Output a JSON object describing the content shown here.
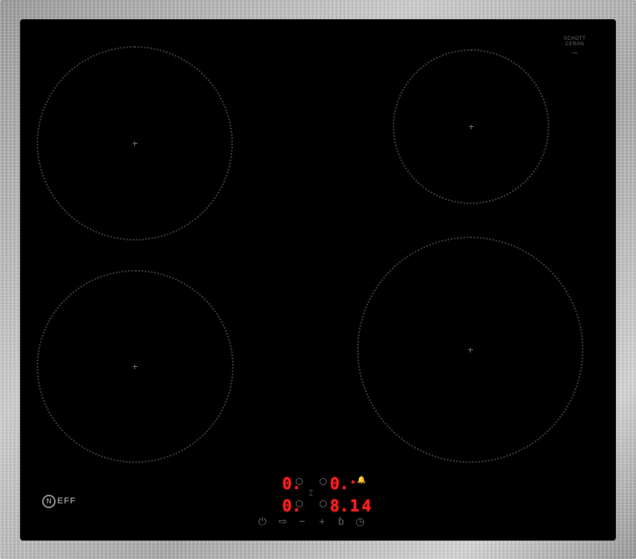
{
  "glass_ceramic": {
    "line1": "SCHOTT",
    "line2": "CERAN",
    "line3": "TM",
    "line4": ""
  },
  "brand": {
    "logo_letter": "N",
    "logo_text": "EFF"
  },
  "display": {
    "zone_left_top": "0.",
    "zone_left_bottom": "0.",
    "zone_right_top": "0.",
    "zone_right_bottom": "8.",
    "timer": "14"
  },
  "controls": {
    "power_glyph": "⏻",
    "select_glyph": "⇨",
    "minus_glyph": "−",
    "plus_glyph": "+",
    "lock_glyph": "ɓ",
    "timer_glyph": "◷",
    "bell_glyph": "🔔",
    "link_glyph": "⌶"
  }
}
